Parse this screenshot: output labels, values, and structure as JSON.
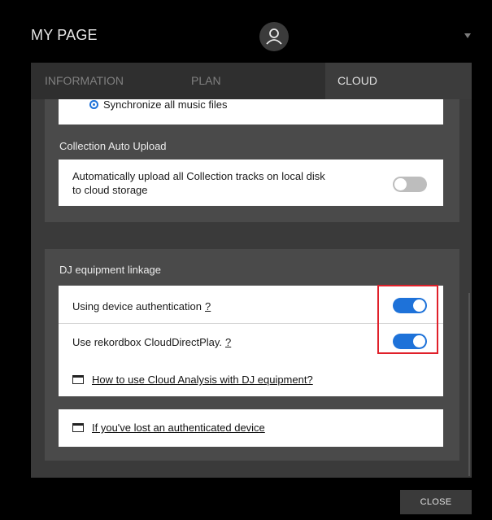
{
  "header": {
    "title": "MY PAGE",
    "avatar_icon": "user-icon",
    "menu_icon": "chevron-down-icon"
  },
  "tabs": [
    {
      "label": "INFORMATION",
      "active": false
    },
    {
      "label": "PLAN",
      "active": false
    },
    {
      "label": "CLOUD",
      "active": true
    }
  ],
  "sync": {
    "option_label": "Synchronize all music files",
    "selected": true
  },
  "collection_upload": {
    "section_label": "Collection Auto Upload",
    "description_line1": "Automatically upload all Collection tracks on local disk",
    "description_line2": "to cloud storage",
    "enabled": false
  },
  "dj_linkage": {
    "section_label": "DJ equipment linkage",
    "device_auth_label": "Using device authentication",
    "device_auth_help": "?",
    "device_auth_enabled": true,
    "cloud_direct_play_label": "Use rekordbox CloudDirectPlay.",
    "cloud_direct_play_help": "?",
    "cloud_direct_play_enabled": true,
    "analysis_link": "How to use Cloud Analysis with DJ equipment?",
    "lost_device_link": "If you've lost an authenticated device"
  },
  "footer": {
    "close_label": "CLOSE"
  },
  "colors": {
    "accent": "#1e72d9",
    "highlight": "#e0202a",
    "toggle_off": "#bdbdbd"
  }
}
